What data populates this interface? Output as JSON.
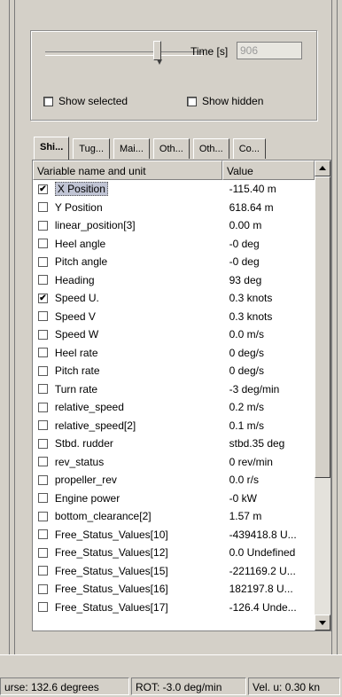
{
  "controls": {
    "time_label": "Time [s]",
    "time_value": "906",
    "show_selected_label": "Show selected",
    "show_hidden_label": "Show hidden"
  },
  "tabs": [
    "Shi...",
    "Tug...",
    "Mai...",
    "Oth...",
    "Oth...",
    "Co..."
  ],
  "table": {
    "headers": [
      "Variable name and unit",
      "Value"
    ],
    "rows": [
      {
        "name": "X Position",
        "value": "-115.40 m",
        "checked": true
      },
      {
        "name": "Y Position",
        "value": "618.64 m",
        "checked": false
      },
      {
        "name": "linear_position[3]",
        "value": "0.00 m",
        "checked": false
      },
      {
        "name": "Heel angle",
        "value": "-0 deg",
        "checked": false
      },
      {
        "name": "Pitch angle",
        "value": "-0 deg",
        "checked": false
      },
      {
        "name": "Heading",
        "value": "93 deg",
        "checked": false
      },
      {
        "name": "Speed U.",
        "value": "0.3 knots",
        "checked": true
      },
      {
        "name": "Speed V",
        "value": "0.3 knots",
        "checked": false
      },
      {
        "name": "Speed W",
        "value": "0.0 m/s",
        "checked": false
      },
      {
        "name": "Heel rate",
        "value": "0 deg/s",
        "checked": false
      },
      {
        "name": "Pitch rate",
        "value": "0 deg/s",
        "checked": false
      },
      {
        "name": "Turn rate",
        "value": "-3 deg/min",
        "checked": false
      },
      {
        "name": "relative_speed",
        "value": "0.2 m/s",
        "checked": false
      },
      {
        "name": "relative_speed[2]",
        "value": "0.1 m/s",
        "checked": false
      },
      {
        "name": "Stbd. rudder",
        "value": "stbd.35 deg",
        "checked": false
      },
      {
        "name": "rev_status",
        "value": "0 rev/min",
        "checked": false
      },
      {
        "name": "propeller_rev",
        "value": "0.0 r/s",
        "checked": false
      },
      {
        "name": "Engine power",
        "value": "-0 kW",
        "checked": false
      },
      {
        "name": "bottom_clearance[2]",
        "value": "1.57 m",
        "checked": false
      },
      {
        "name": "Free_Status_Values[10]",
        "value": "-439418.8 U...",
        "checked": false
      },
      {
        "name": "Free_Status_Values[12]",
        "value": "0.0 Undefined",
        "checked": false
      },
      {
        "name": "Free_Status_Values[15]",
        "value": "-221169.2 U...",
        "checked": false
      },
      {
        "name": "Free_Status_Values[16]",
        "value": "182197.8 U...",
        "checked": false
      },
      {
        "name": "Free_Status_Values[17]",
        "value": "-126.4 Unde...",
        "checked": false
      }
    ]
  },
  "status_bar": {
    "course": "urse: 132.6 degrees",
    "rot": "ROT: -3.0 deg/min",
    "vel": "Vel. u: 0.30 kn"
  }
}
